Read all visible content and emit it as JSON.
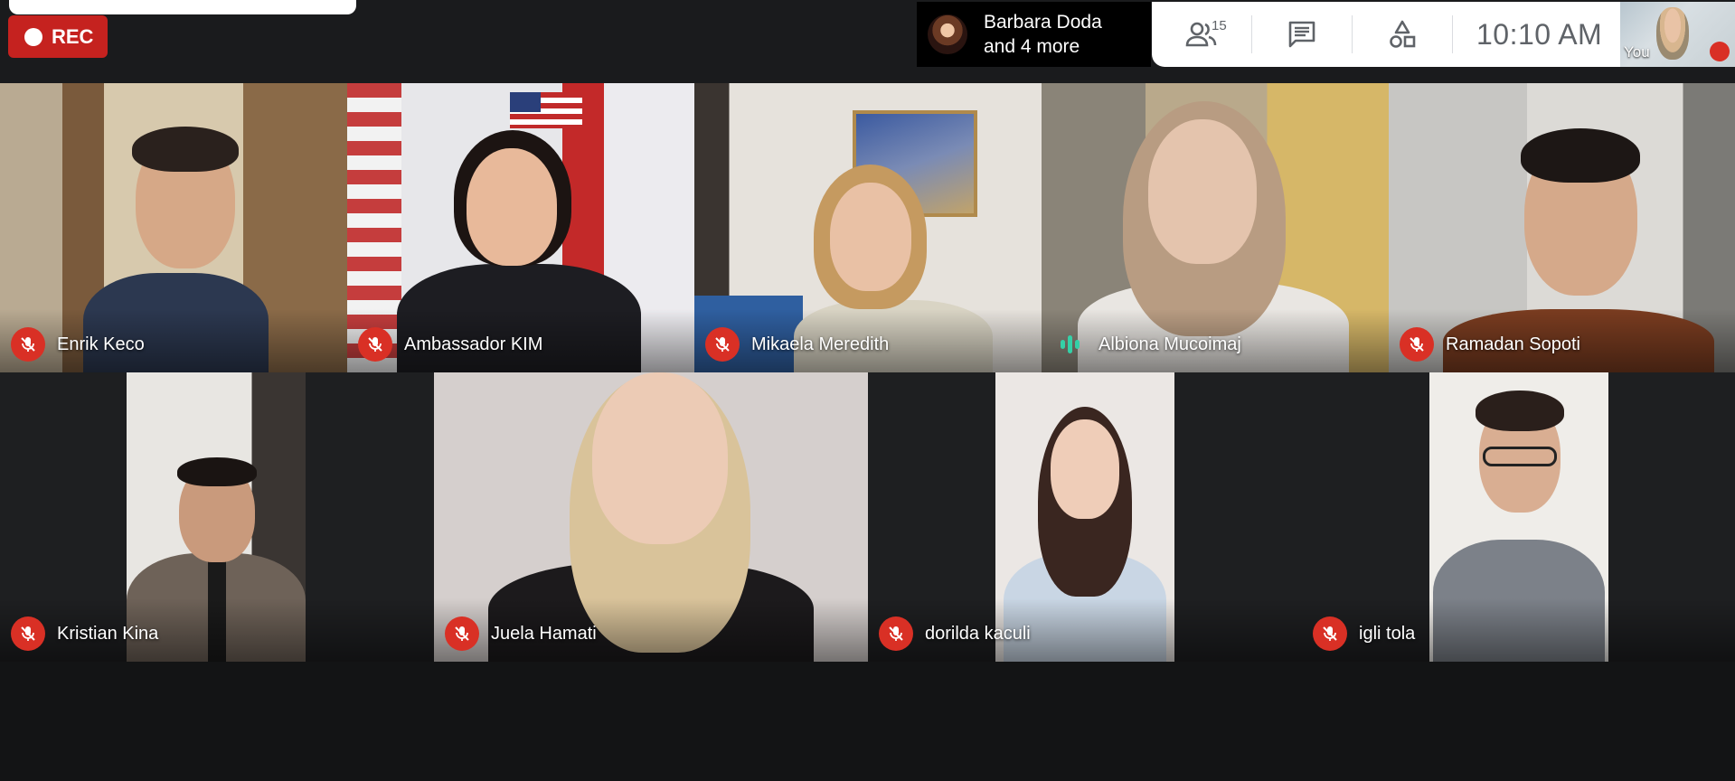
{
  "recording": {
    "label": "REC"
  },
  "presenter": {
    "name": "Barbara Doda",
    "more": "and 4 more"
  },
  "panel": {
    "participant_count": "15",
    "clock": "10:10  AM"
  },
  "self_view": {
    "label": "You"
  },
  "participants": [
    {
      "name": "Enrik Keco",
      "muted": true
    },
    {
      "name": "Ambassador KIM",
      "muted": true
    },
    {
      "name": "Mikaela Meredith",
      "muted": true
    },
    {
      "name": "Albiona Mucoimaj",
      "muted": false,
      "speaking": true
    },
    {
      "name": "Ramadan Sopoti",
      "muted": true
    },
    {
      "name": "Kristian Kina",
      "muted": true
    },
    {
      "name": "Juela Hamati",
      "muted": true
    },
    {
      "name": "dorilda kaculi",
      "muted": true
    },
    {
      "name": "igli tola",
      "muted": true
    }
  ],
  "colors": {
    "mute_red": "#d93025",
    "rec_red": "#c5221f",
    "speaking_green": "#34d0a7",
    "background": "#131415"
  },
  "icons": [
    "people-icon",
    "chat-icon",
    "activities-icon",
    "mic-off-icon",
    "speaking-indicator-icon"
  ]
}
